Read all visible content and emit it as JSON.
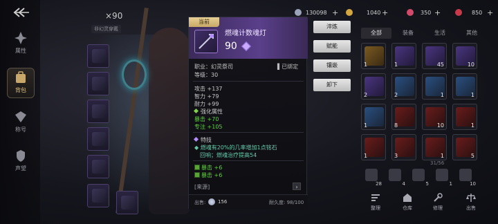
{
  "nav": {
    "items": [
      {
        "label": "属性",
        "icon": "attribute-icon"
      },
      {
        "label": "背包",
        "icon": "backpack-icon",
        "active": true
      },
      {
        "label": "称号",
        "icon": "title-icon"
      },
      {
        "label": "声望",
        "icon": "reputation-icon"
      }
    ]
  },
  "character": {
    "count": "×90",
    "tag": "非幻灵穿戴"
  },
  "currencies": [
    {
      "value": "130098",
      "icon": "silver-coin-icon",
      "color": "#9aa3b8"
    },
    {
      "value": "1040",
      "icon": "gold-coin-icon",
      "color": "#d4a640"
    },
    {
      "value": "350",
      "icon": "gem-icon",
      "color": "#d24a6a"
    },
    {
      "value": "850",
      "icon": "crystal-icon",
      "color": "#c83a4a"
    }
  ],
  "tooltip": {
    "badge": "当前",
    "name": "燃魂计数魂灯",
    "power": "90",
    "class_line": "职业：幻灵祭司",
    "level_line": "等级：30",
    "bound": "已绑定",
    "stats": [
      "攻击 +137",
      "智力 +79",
      "耐力 +99"
    ],
    "enhance_title": "强化属性",
    "enhance": [
      "暴击 +70",
      "专注 +105"
    ],
    "skill_title": "特技",
    "skill_desc_1": "燃魂有20%的几率增加1点铭石",
    "skill_desc_2": "回响；燃魂治疗提高54",
    "gems": [
      "暴击 +6",
      "暴击 +6"
    ],
    "source": "[来源]",
    "sell_label": "出售:",
    "sell_value": "156",
    "durability": "耐久度: 98/100"
  },
  "actions": [
    "淬炼",
    "赋能",
    "镶嵌",
    "卸下"
  ],
  "inventory": {
    "tabs": [
      "全部",
      "装备",
      "生活",
      "其他"
    ],
    "capacity": "31/56",
    "cells": [
      {
        "rarity": "gold",
        "count": "1",
        "icon": "gold-gem-icon"
      },
      {
        "rarity": "purple",
        "count": "1",
        "icon": "purple-gem-icon"
      },
      {
        "rarity": "purple",
        "count": "45",
        "icon": "purple-crystal-icon"
      },
      {
        "rarity": "purple",
        "count": "10",
        "icon": "purple-shard-icon"
      },
      {
        "rarity": "purple",
        "count": "2",
        "icon": "helmet-icon"
      },
      {
        "rarity": "blue",
        "count": "2",
        "icon": "gauntlet-icon"
      },
      {
        "rarity": "blue",
        "count": "1",
        "icon": "armor-icon"
      },
      {
        "rarity": "blue",
        "count": "1",
        "icon": "boots-icon"
      },
      {
        "rarity": "blue",
        "count": "1",
        "icon": "belt-icon"
      },
      {
        "rarity": "red",
        "count": "8",
        "icon": "red-scroll-icon"
      },
      {
        "rarity": "red",
        "count": "10",
        "icon": "red-potion-icon"
      },
      {
        "rarity": "red",
        "count": "1",
        "icon": "red-orb-icon"
      },
      {
        "rarity": "red",
        "count": "1",
        "icon": "red-feather-icon"
      },
      {
        "rarity": "red",
        "count": "3",
        "icon": "red-stone-icon"
      },
      {
        "rarity": "red",
        "count": "1",
        "icon": "red-flask-icon"
      },
      {
        "rarity": "red",
        "count": "5",
        "icon": "red-crystal-icon"
      }
    ],
    "mini": [
      {
        "count": "28",
        "icon": "pouch-icon"
      },
      {
        "count": "4",
        "icon": "bag-icon"
      },
      {
        "count": "5",
        "icon": "box-icon"
      },
      {
        "count": "1",
        "icon": "sack-icon"
      },
      {
        "count": "10",
        "icon": "vial-icon"
      }
    ],
    "bottom": [
      {
        "label": "整理",
        "icon": "sort-icon"
      },
      {
        "label": "仓库",
        "icon": "warehouse-icon"
      },
      {
        "label": "修理",
        "icon": "repair-icon"
      },
      {
        "label": "出售",
        "icon": "sell-scale-icon"
      }
    ]
  }
}
